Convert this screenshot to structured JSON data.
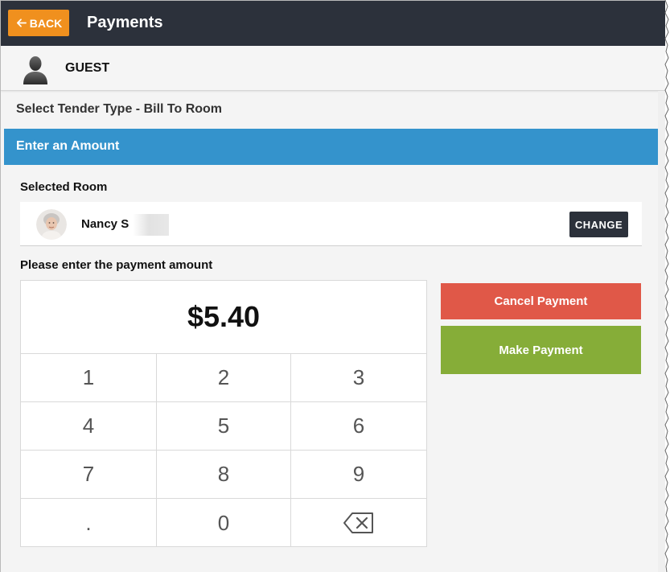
{
  "header": {
    "back_label": "BACK",
    "title": "Payments",
    "back_color": "#f0901e",
    "bar_color": "#2c313b"
  },
  "guest": {
    "name": "GUEST",
    "avatar_icon": "person-silhouette-icon"
  },
  "tender": {
    "label": "Select Tender Type - Bill To Room"
  },
  "amount_section": {
    "banner_label": "Enter an Amount",
    "banner_color": "#3493cc"
  },
  "room": {
    "section_label": "Selected Room",
    "guest_name": "Nancy S",
    "change_label": "CHANGE"
  },
  "payment": {
    "prompt": "Please enter the payment amount",
    "amount": "$5.40",
    "keys": [
      "1",
      "2",
      "3",
      "4",
      "5",
      "6",
      "7",
      "8",
      "9",
      ".",
      "0"
    ],
    "backspace_icon": "backspace-icon"
  },
  "actions": {
    "cancel_label": "Cancel Payment",
    "cancel_color": "#e05848",
    "make_label": "Make Payment",
    "make_color": "#86ad38"
  }
}
